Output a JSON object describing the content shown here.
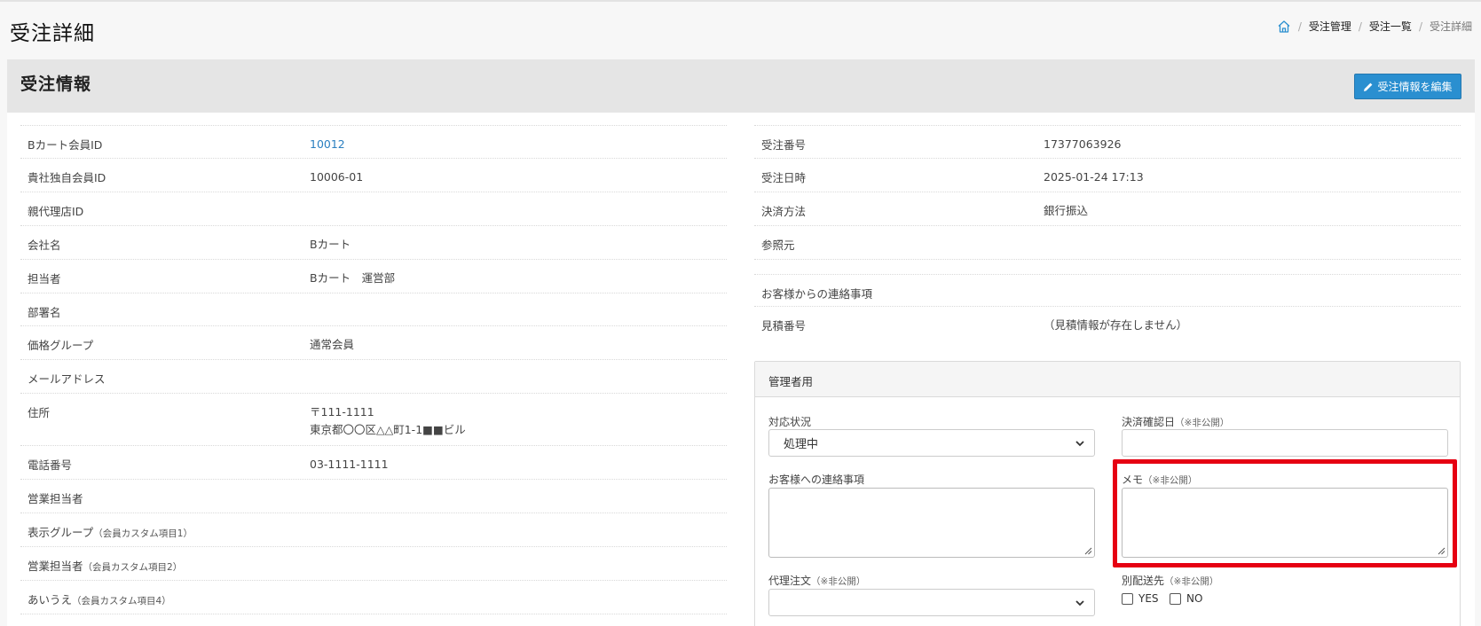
{
  "page": {
    "title": "受注詳細"
  },
  "breadcrumb": {
    "items": [
      "受注管理",
      "受注一覧",
      "受注詳細"
    ]
  },
  "panel": {
    "title": "受注情報",
    "edit_button": "受注情報を編集"
  },
  "left_rows": [
    {
      "label": "Bカート会員ID",
      "value": "10012"
    },
    {
      "label": "貴社独自会員ID",
      "value": "10006-01"
    },
    {
      "label": "親代理店ID",
      "value": ""
    },
    {
      "label": "会社名",
      "value": "Bカート"
    },
    {
      "label": "担当者",
      "value": "Bカート　運営部"
    },
    {
      "label": "部署名",
      "value": ""
    },
    {
      "label": "価格グループ",
      "value": "通常会員"
    },
    {
      "label": "メールアドレス",
      "value": ""
    },
    {
      "label": "住所",
      "value": "〒111-1111",
      "value2": "東京都〇〇区△△町1-1■■ビル"
    },
    {
      "label": "電話番号",
      "value": "03-1111-1111"
    },
    {
      "label": "営業担当者",
      "value": ""
    },
    {
      "label": "表示グループ",
      "sub": "（会員カスタム項目1）",
      "value": ""
    },
    {
      "label": "営業担当者",
      "sub": "（会員カスタム項目2）",
      "value": ""
    },
    {
      "label": "あいうえ",
      "sub": "（会員カスタム項目4）",
      "value": ""
    }
  ],
  "right_rows": [
    {
      "label": "受注番号",
      "value": "17377063926"
    },
    {
      "label": "受注日時",
      "value": "2025-01-24 17:13"
    },
    {
      "label": "決済方法",
      "value": "銀行振込"
    },
    {
      "label": "参照元",
      "value": ""
    },
    {
      "label": "お客様からの連絡事項",
      "value": ""
    },
    {
      "label": "見積番号",
      "value": "（見積情報が存在しません）"
    }
  ],
  "admin": {
    "title": "管理者用",
    "status_label": "対応状況",
    "status_value": "処理中",
    "payment_date_label": "決済確認日",
    "private_note": "（※非公開）",
    "customer_message_label": "お客様への連絡事項",
    "memo_label": "メモ",
    "proxy_order_label": "代理注文",
    "separate_address_label": "別配送先",
    "yes_label": "YES",
    "no_label": "NO"
  },
  "colors": {
    "accent": "#2a8fd0",
    "link": "#2a7fc0",
    "highlight": "#e60012"
  }
}
